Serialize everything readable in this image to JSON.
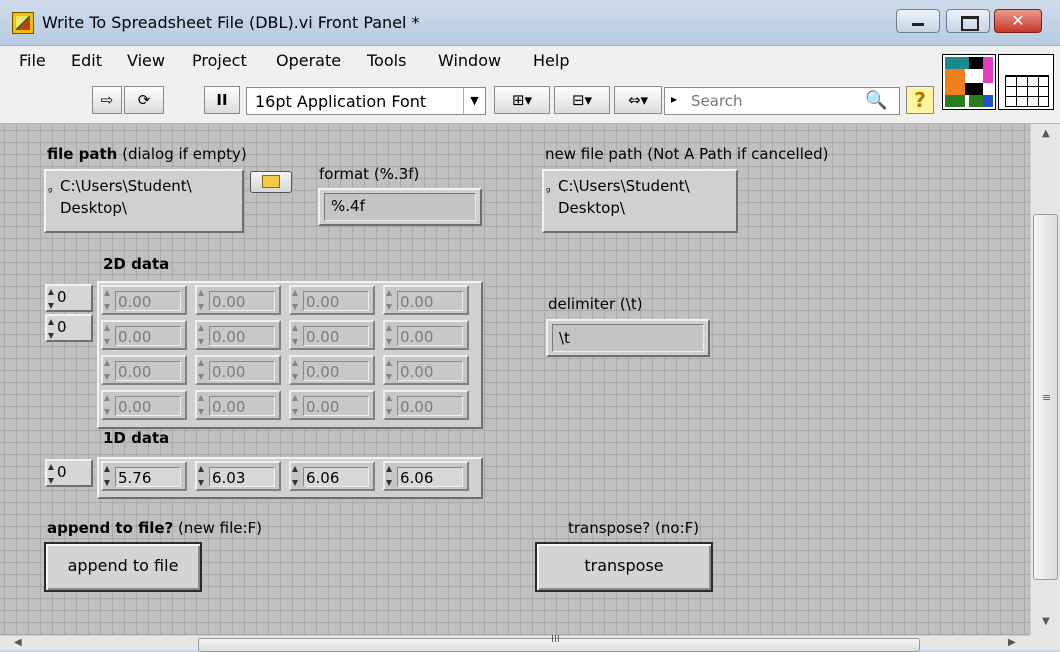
{
  "window": {
    "title": "Write To Spreadsheet File (DBL).vi Front Panel *",
    "close_glyph": "✕"
  },
  "menu": [
    "File",
    "Edit",
    "View",
    "Project",
    "Operate",
    "Tools",
    "Window",
    "Help"
  ],
  "toolbar": {
    "run_glyph": "⇨",
    "run_continuously_glyph": "⟳",
    "pause_glyph": "II",
    "font_select_value": "16pt Application Font",
    "font_select_arrow": "▼",
    "align_glyph": "⊞▾",
    "distribute_glyph": "⊟▾",
    "resize_glyph": "⇔▾",
    "reorder_glyph": "▸",
    "search_placeholder": "Search",
    "search_icon": "🔍",
    "help_glyph": "?"
  },
  "colors": {
    "panel_bg": "#c0c0c0",
    "grid_line": "#a9a9a9",
    "titlebar": "#c8d6e6",
    "close_button": "#c8372a"
  },
  "controls": {
    "file_path": {
      "label_bold": "file path",
      "label_rest": " (dialog if empty)",
      "line1": "C:\\Users\\Student\\",
      "line2": "Desktop\\",
      "glyph": "ᵍ"
    },
    "format": {
      "label": "format (%.3f)",
      "value": "%.4f"
    },
    "new_file_path": {
      "label": "new file path (Not A Path if cancelled)",
      "line1": "C:\\Users\\Student\\",
      "line2": "Desktop\\",
      "glyph": "ᵍ"
    },
    "delimiter": {
      "label": "delimiter (\\t)",
      "value": "\\t"
    },
    "data_2d": {
      "label": "2D data",
      "index_row": "0",
      "index_col": "0",
      "rows": [
        [
          "0.00",
          "0.00",
          "0.00",
          "0.00"
        ],
        [
          "0.00",
          "0.00",
          "0.00",
          "0.00"
        ],
        [
          "0.00",
          "0.00",
          "0.00",
          "0.00"
        ],
        [
          "0.00",
          "0.00",
          "0.00",
          "0.00"
        ]
      ]
    },
    "data_1d": {
      "label": "1D data",
      "index": "0",
      "values": [
        "5.76",
        "6.03",
        "6.06",
        "6.06"
      ]
    },
    "append": {
      "label_bold": "append to file?",
      "label_rest": " (new file:F)",
      "button_text": "append to file"
    },
    "transpose": {
      "label": "transpose? (no:F)",
      "button_text": "transpose"
    }
  },
  "scroll": {
    "up": "▲",
    "down": "▼",
    "left": "◀",
    "right": "▶",
    "grip_v": "≡",
    "grip_h": "III"
  }
}
